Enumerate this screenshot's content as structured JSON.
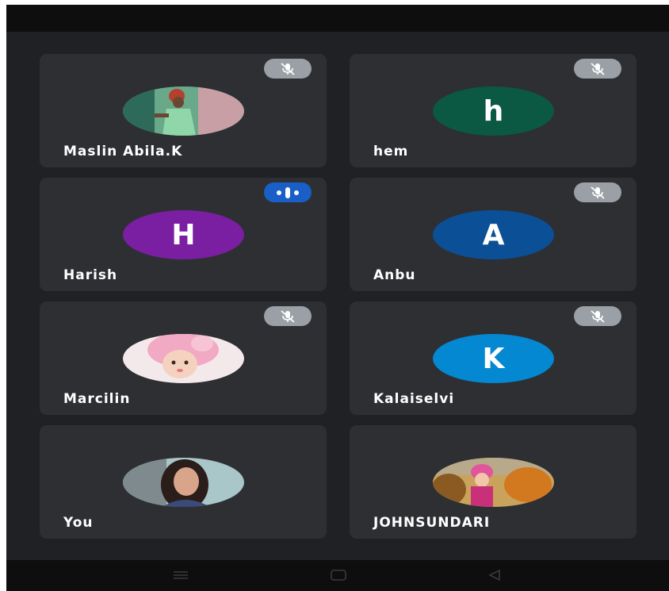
{
  "participants": [
    {
      "name": "Maslin Abila.K",
      "avatar_type": "photo",
      "photo_icon": "child-photo",
      "status": "muted",
      "status_icon": "mic-off-icon"
    },
    {
      "name": "hem",
      "avatar_type": "initial",
      "initial": "h",
      "color": "#0b5843",
      "status": "muted",
      "status_icon": "mic-off-icon"
    },
    {
      "name": "Harish",
      "avatar_type": "initial",
      "initial": "H",
      "color": "#7b1fa2",
      "status": "speaking",
      "status_icon": "audio-level-icon"
    },
    {
      "name": "Anbu",
      "avatar_type": "initial",
      "initial": "A",
      "color": "#0b4f97",
      "status": "muted",
      "status_icon": "mic-off-icon"
    },
    {
      "name": "Marcilin",
      "avatar_type": "photo",
      "photo_icon": "baby-photo",
      "status": "muted",
      "status_icon": "mic-off-icon"
    },
    {
      "name": "Kalaiselvi",
      "avatar_type": "initial",
      "initial": "K",
      "color": "#0388d1",
      "status": "muted",
      "status_icon": "mic-off-icon"
    },
    {
      "name": "You",
      "avatar_type": "photo",
      "photo_icon": "woman-photo",
      "status": "",
      "status_icon": ""
    },
    {
      "name": "JOHNSUNDARI",
      "avatar_type": "photo",
      "photo_icon": "child-autumn-photo",
      "status": "",
      "status_icon": ""
    }
  ],
  "colors": {
    "background": "#202124",
    "tile": "#2e2f33",
    "muted_badge": "#9aa0a6",
    "speaking_badge": "#1a5fc7",
    "bars": "#0e0e0f"
  },
  "navbar": {
    "icons": [
      "menu-icon",
      "home-icon",
      "back-icon"
    ]
  }
}
